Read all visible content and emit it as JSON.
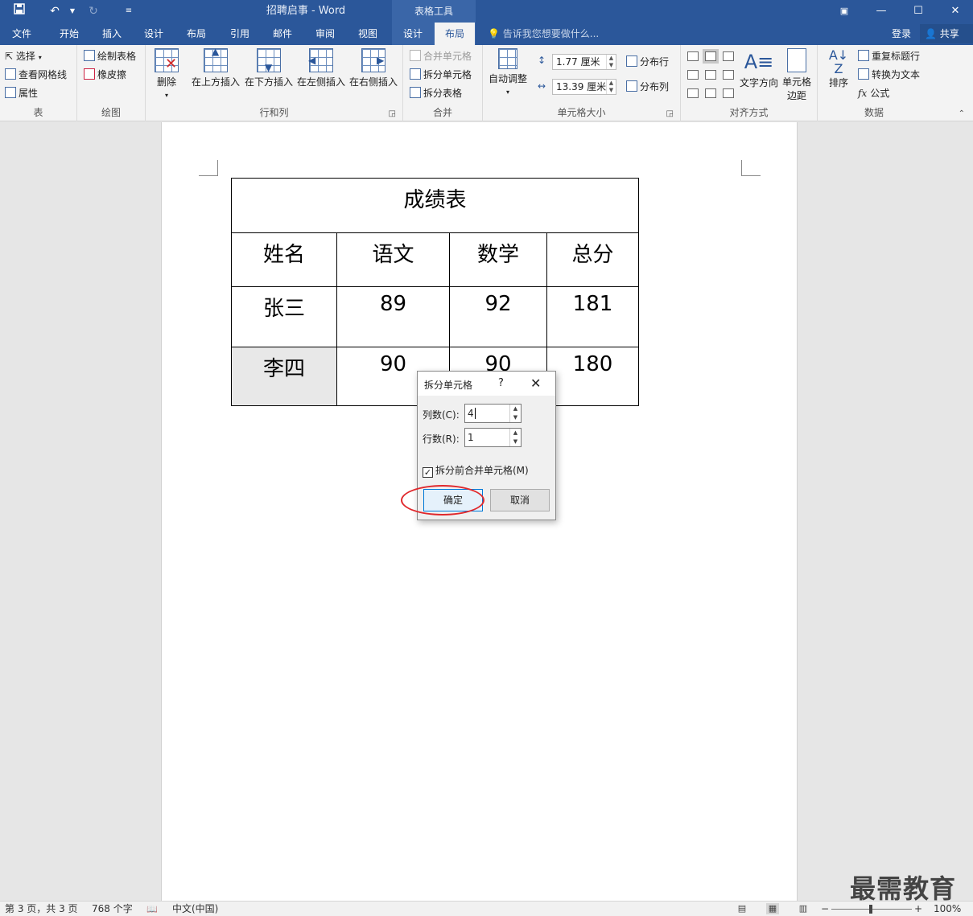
{
  "title_bar": {
    "document_title": "招聘启事 - Word",
    "context_title": "表格工具",
    "quick_access": [
      "save-icon",
      "undo-icon",
      "redo-icon",
      "customize-icon"
    ],
    "window_controls": [
      "ribbon-display-icon",
      "minimize-icon",
      "maximize-icon",
      "close-icon"
    ]
  },
  "tabs": {
    "items": [
      "文件",
      "开始",
      "插入",
      "设计",
      "布局",
      "引用",
      "邮件",
      "审阅",
      "视图"
    ],
    "context_items": [
      "设计",
      "布局"
    ],
    "active": "布局",
    "tell_me": "告诉我您想要做什么...",
    "login": "登录",
    "share": "共享"
  },
  "ribbon": {
    "table_group": {
      "label": "表",
      "select": "选择",
      "view_gridlines": "查看网格线",
      "properties": "属性"
    },
    "draw_group": {
      "label": "绘图",
      "draw_table": "绘制表格",
      "eraser": "橡皮擦"
    },
    "delete_btn": "删除",
    "rows_cols_group": {
      "label": "行和列",
      "insert_above": "在上方插入",
      "insert_below": "在下方插入",
      "insert_left": "在左侧插入",
      "insert_right": "在右侧插入"
    },
    "merge_group": {
      "label": "合并",
      "merge_cells": "合并单元格",
      "split_cells": "拆分单元格",
      "split_table": "拆分表格"
    },
    "cell_size_group": {
      "label": "单元格大小",
      "autofit": "自动调整",
      "height_value": "1.77 厘米",
      "width_value": "13.39 厘米",
      "distribute_rows": "分布行",
      "distribute_cols": "分布列"
    },
    "alignment_group": {
      "label": "对齐方式",
      "text_direction": "文字方向",
      "cell_margins_line1": "单元格",
      "cell_margins_line2": "边距"
    },
    "data_group": {
      "label": "数据",
      "sort": "排序",
      "repeat_header": "重复标题行",
      "convert_to_text": "转换为文本",
      "formula": "公式"
    }
  },
  "document": {
    "table_title": "成绩表",
    "headers": [
      "姓名",
      "语文",
      "数学",
      "总分"
    ],
    "rows": [
      [
        "张三",
        "89",
        "92",
        "181"
      ],
      [
        "李四",
        "90",
        "90",
        "180"
      ]
    ]
  },
  "dialog": {
    "title": "拆分单元格",
    "help": "?",
    "columns_label": "列数(C):",
    "columns_value": "4",
    "rows_label": "行数(R):",
    "rows_value": "1",
    "merge_checkbox_label": "拆分前合并单元格(M)",
    "merge_checked": true,
    "ok_label": "确定",
    "cancel_label": "取消"
  },
  "status_bar": {
    "page_info": "第 3 页，共 3 页",
    "word_count": "768 个字",
    "language": "中文(中国)",
    "zoom": "100%"
  },
  "watermark": "最需教育",
  "colors": {
    "ribbon_blue": "#2b579a",
    "highlight_red": "#e0282c",
    "ok_border": "#0078d7"
  }
}
